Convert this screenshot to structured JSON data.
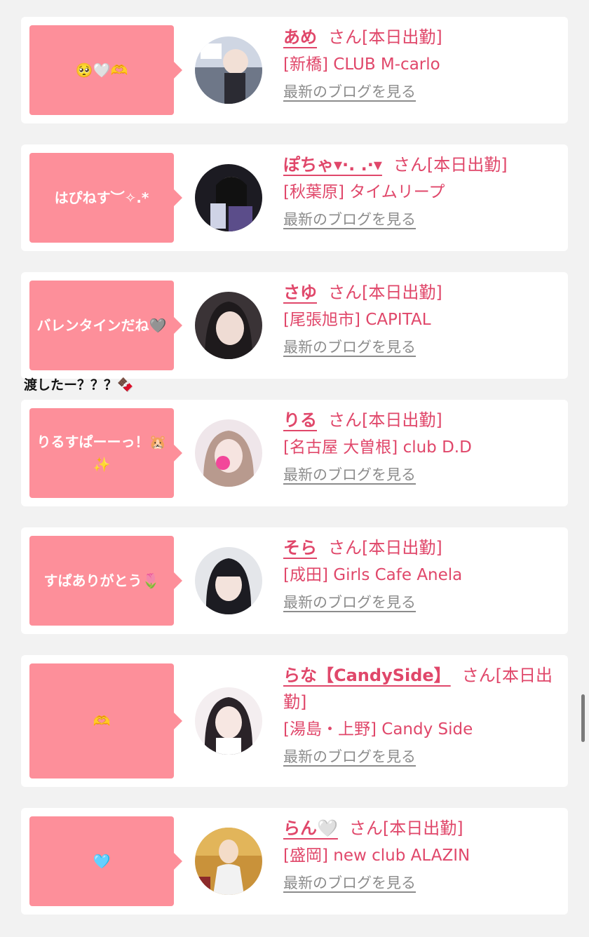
{
  "cards": [
    {
      "bubble": "🥺🤍🫶",
      "name": "あめ",
      "honor": "さん[本日出勤]",
      "shop": "[新橋] CLUB M-carlo",
      "blog": "最新のブログを見る",
      "avatar": "avatar-photo"
    },
    {
      "bubble": "はぴねす︶✧.*",
      "name": "ぽちゃ▾·. .·▾",
      "honor": "さん[本日出勤]",
      "shop": "[秋葉原] タイムリープ",
      "blog": "最新のブログを見る",
      "avatar": "avatar-photo"
    },
    {
      "bubble": "バレンタインだね🩶",
      "name": "さゆ",
      "honor": "さん[本日出勤]",
      "shop": "[尾張旭市] CAPITAL",
      "blog": "最新のブログを見る",
      "avatar": "avatar-photo"
    },
    {
      "bubble": "りるすぱーーっ！🐹✨",
      "name": "りる",
      "honor": "さん[本日出勤]",
      "shop": "[名古屋 大曽根] club D.D",
      "blog": "最新のブログを見る",
      "avatar": "avatar-photo"
    },
    {
      "bubble": "すぱありがとう🌷",
      "name": "そら",
      "honor": "さん[本日出勤]",
      "shop": "[成田] Girls Cafe Anela",
      "blog": "最新のブログを見る",
      "avatar": "avatar-photo"
    },
    {
      "bubble": "🫶",
      "name": "らな【CandySide】",
      "honor": "さん[本日出勤]",
      "shop": "[湯島・上野] Candy Side",
      "blog": "最新のブログを見る",
      "avatar": "avatar-photo"
    },
    {
      "bubble": "🩵",
      "name": "らん🤍",
      "honor": "さん[本日出勤]",
      "shop": "[盛岡] new club ALAZIN",
      "blog": "最新のブログを見る",
      "avatar": "avatar-photo"
    }
  ],
  "overflow_caption": "渡したー？？？🍫",
  "colors": {
    "bubble": "#fd8f9a",
    "name": "#e0476a",
    "blog_link": "#8c8c8c",
    "background": "#f2f2f2"
  }
}
